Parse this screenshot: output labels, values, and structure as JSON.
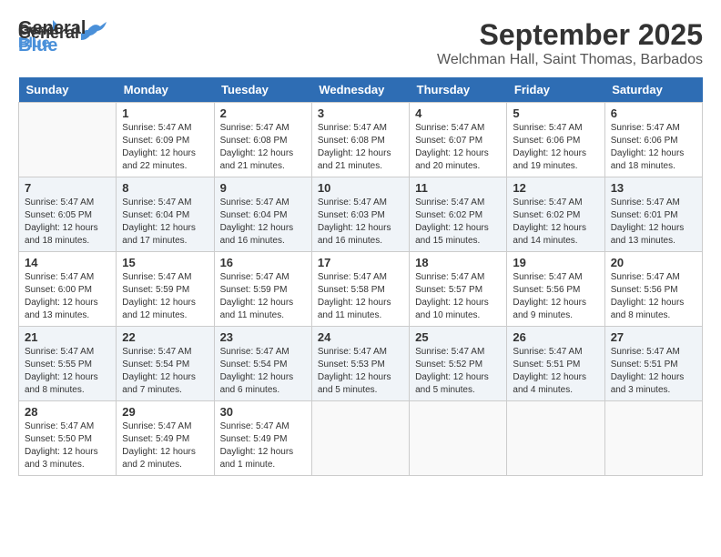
{
  "header": {
    "logo_line1": "General",
    "logo_line2": "Blue",
    "month": "September 2025",
    "location": "Welchman Hall, Saint Thomas, Barbados"
  },
  "weekdays": [
    "Sunday",
    "Monday",
    "Tuesday",
    "Wednesday",
    "Thursday",
    "Friday",
    "Saturday"
  ],
  "weeks": [
    [
      {
        "day": "",
        "info": ""
      },
      {
        "day": "1",
        "info": "Sunrise: 5:47 AM\nSunset: 6:09 PM\nDaylight: 12 hours\nand 22 minutes."
      },
      {
        "day": "2",
        "info": "Sunrise: 5:47 AM\nSunset: 6:08 PM\nDaylight: 12 hours\nand 21 minutes."
      },
      {
        "day": "3",
        "info": "Sunrise: 5:47 AM\nSunset: 6:08 PM\nDaylight: 12 hours\nand 21 minutes."
      },
      {
        "day": "4",
        "info": "Sunrise: 5:47 AM\nSunset: 6:07 PM\nDaylight: 12 hours\nand 20 minutes."
      },
      {
        "day": "5",
        "info": "Sunrise: 5:47 AM\nSunset: 6:06 PM\nDaylight: 12 hours\nand 19 minutes."
      },
      {
        "day": "6",
        "info": "Sunrise: 5:47 AM\nSunset: 6:06 PM\nDaylight: 12 hours\nand 18 minutes."
      }
    ],
    [
      {
        "day": "7",
        "info": "Sunrise: 5:47 AM\nSunset: 6:05 PM\nDaylight: 12 hours\nand 18 minutes."
      },
      {
        "day": "8",
        "info": "Sunrise: 5:47 AM\nSunset: 6:04 PM\nDaylight: 12 hours\nand 17 minutes."
      },
      {
        "day": "9",
        "info": "Sunrise: 5:47 AM\nSunset: 6:04 PM\nDaylight: 12 hours\nand 16 minutes."
      },
      {
        "day": "10",
        "info": "Sunrise: 5:47 AM\nSunset: 6:03 PM\nDaylight: 12 hours\nand 16 minutes."
      },
      {
        "day": "11",
        "info": "Sunrise: 5:47 AM\nSunset: 6:02 PM\nDaylight: 12 hours\nand 15 minutes."
      },
      {
        "day": "12",
        "info": "Sunrise: 5:47 AM\nSunset: 6:02 PM\nDaylight: 12 hours\nand 14 minutes."
      },
      {
        "day": "13",
        "info": "Sunrise: 5:47 AM\nSunset: 6:01 PM\nDaylight: 12 hours\nand 13 minutes."
      }
    ],
    [
      {
        "day": "14",
        "info": "Sunrise: 5:47 AM\nSunset: 6:00 PM\nDaylight: 12 hours\nand 13 minutes."
      },
      {
        "day": "15",
        "info": "Sunrise: 5:47 AM\nSunset: 5:59 PM\nDaylight: 12 hours\nand 12 minutes."
      },
      {
        "day": "16",
        "info": "Sunrise: 5:47 AM\nSunset: 5:59 PM\nDaylight: 12 hours\nand 11 minutes."
      },
      {
        "day": "17",
        "info": "Sunrise: 5:47 AM\nSunset: 5:58 PM\nDaylight: 12 hours\nand 11 minutes."
      },
      {
        "day": "18",
        "info": "Sunrise: 5:47 AM\nSunset: 5:57 PM\nDaylight: 12 hours\nand 10 minutes."
      },
      {
        "day": "19",
        "info": "Sunrise: 5:47 AM\nSunset: 5:56 PM\nDaylight: 12 hours\nand 9 minutes."
      },
      {
        "day": "20",
        "info": "Sunrise: 5:47 AM\nSunset: 5:56 PM\nDaylight: 12 hours\nand 8 minutes."
      }
    ],
    [
      {
        "day": "21",
        "info": "Sunrise: 5:47 AM\nSunset: 5:55 PM\nDaylight: 12 hours\nand 8 minutes."
      },
      {
        "day": "22",
        "info": "Sunrise: 5:47 AM\nSunset: 5:54 PM\nDaylight: 12 hours\nand 7 minutes."
      },
      {
        "day": "23",
        "info": "Sunrise: 5:47 AM\nSunset: 5:54 PM\nDaylight: 12 hours\nand 6 minutes."
      },
      {
        "day": "24",
        "info": "Sunrise: 5:47 AM\nSunset: 5:53 PM\nDaylight: 12 hours\nand 5 minutes."
      },
      {
        "day": "25",
        "info": "Sunrise: 5:47 AM\nSunset: 5:52 PM\nDaylight: 12 hours\nand 5 minutes."
      },
      {
        "day": "26",
        "info": "Sunrise: 5:47 AM\nSunset: 5:51 PM\nDaylight: 12 hours\nand 4 minutes."
      },
      {
        "day": "27",
        "info": "Sunrise: 5:47 AM\nSunset: 5:51 PM\nDaylight: 12 hours\nand 3 minutes."
      }
    ],
    [
      {
        "day": "28",
        "info": "Sunrise: 5:47 AM\nSunset: 5:50 PM\nDaylight: 12 hours\nand 3 minutes."
      },
      {
        "day": "29",
        "info": "Sunrise: 5:47 AM\nSunset: 5:49 PM\nDaylight: 12 hours\nand 2 minutes."
      },
      {
        "day": "30",
        "info": "Sunrise: 5:47 AM\nSunset: 5:49 PM\nDaylight: 12 hours\nand 1 minute."
      },
      {
        "day": "",
        "info": ""
      },
      {
        "day": "",
        "info": ""
      },
      {
        "day": "",
        "info": ""
      },
      {
        "day": "",
        "info": ""
      }
    ]
  ]
}
